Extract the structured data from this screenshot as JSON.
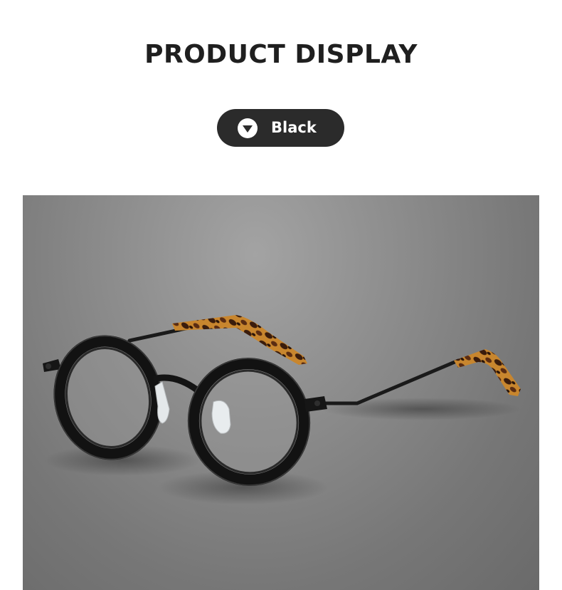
{
  "header": {
    "title": "PRODUCT DISPLAY"
  },
  "color_selector": {
    "icon": "chevron-down-icon",
    "selected_label": "Black"
  },
  "product_image": {
    "subject": "eyeglasses-icon",
    "colors": {
      "frame": "#141414",
      "tortoise_dark": "#3a1c0c",
      "tortoise_light": "#c8862e",
      "background": "#8a8a8a"
    }
  }
}
